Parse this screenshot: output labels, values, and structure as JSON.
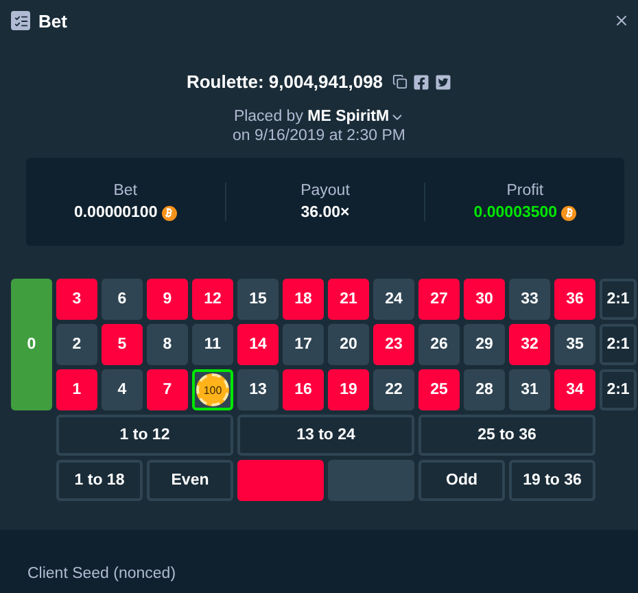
{
  "window": {
    "title": "Bet"
  },
  "game": {
    "title": "Roulette: 9,004,941,098",
    "placed_by": "Placed by **ME SpiritM**",
    "date": "on 9/16/2019 at 2:30 PM"
  },
  "stats": [
    {
      "label": "Bet",
      "value": "0.00000100",
      "kind": "coin",
      "positive": false
    },
    {
      "label": "Payout",
      "value": "36.00×",
      "kind": "plain",
      "positive": false
    },
    {
      "label": "Profit",
      "value": "0.00003500",
      "kind": "coin",
      "positive": true
    }
  ],
  "zero": {
    "text": "0"
  },
  "rows": [
    [
      {
        "text": "3",
        "color": "#ff003f"
      },
      {
        "text": "6",
        "color": "#2f4553"
      },
      {
        "text": "9",
        "color": "#ff003f"
      },
      {
        "text": "12",
        "color": "#ff003f"
      },
      {
        "text": "15",
        "color": "#2f4553"
      },
      {
        "text": "18",
        "color": "#ff003f"
      },
      {
        "text": "21",
        "color": "#ff003f"
      },
      {
        "text": "24",
        "color": "#2f4553"
      },
      {
        "text": "27",
        "color": "#ff003f"
      },
      {
        "text": "30",
        "color": "#ff003f"
      },
      {
        "text": "33",
        "color": "#2f4553"
      },
      {
        "text": "36",
        "color": "#ff003f"
      }
    ],
    [
      {
        "text": "2",
        "color": "#2f4553"
      },
      {
        "text": "5",
        "color": "#ff003f"
      },
      {
        "text": "8",
        "color": "#2f4553"
      },
      {
        "text": "11",
        "color": "#2f4553"
      },
      {
        "text": "14",
        "color": "#ff003f"
      },
      {
        "text": "17",
        "color": "#2f4553"
      },
      {
        "text": "20",
        "color": "#2f4553"
      },
      {
        "text": "23",
        "color": "#ff003f"
      },
      {
        "text": "26",
        "color": "#2f4553"
      },
      {
        "text": "29",
        "color": "#2f4553"
      },
      {
        "text": "32",
        "color": "#ff003f"
      },
      {
        "text": "35",
        "color": "#2f4553"
      }
    ],
    [
      {
        "text": "1",
        "color": "#ff003f"
      },
      {
        "text": "4",
        "color": "#2f4553"
      },
      {
        "text": "7",
        "color": "#ff003f"
      },
      {
        "chip": "100",
        "color": "#2f4553",
        "selected": true
      },
      {
        "text": "13",
        "color": "#2f4553"
      },
      {
        "text": "16",
        "color": "#ff003f"
      },
      {
        "text": "19",
        "color": "#ff003f"
      },
      {
        "text": "22",
        "color": "#2f4553"
      },
      {
        "text": "25",
        "color": "#ff003f"
      },
      {
        "text": "28",
        "color": "#2f4553"
      },
      {
        "text": "31",
        "color": "#2f4553"
      },
      {
        "text": "34",
        "color": "#ff003f"
      }
    ]
  ],
  "columns": [
    "2:1",
    "2:1",
    "2:1"
  ],
  "dozens": [
    "1 to 12",
    "13 to 24",
    "25 to 36"
  ],
  "outside": [
    {
      "kind": "label",
      "text": "1 to 18"
    },
    {
      "kind": "label",
      "text": "Even"
    },
    {
      "kind": "swatch",
      "color": "#ff003f"
    },
    {
      "kind": "swatch",
      "color": "#2f4553"
    },
    {
      "kind": "label",
      "text": "Odd"
    },
    {
      "kind": "label",
      "text": "19 to 36"
    }
  ],
  "seed": {
    "label": "Client Seed (nonced)"
  }
}
